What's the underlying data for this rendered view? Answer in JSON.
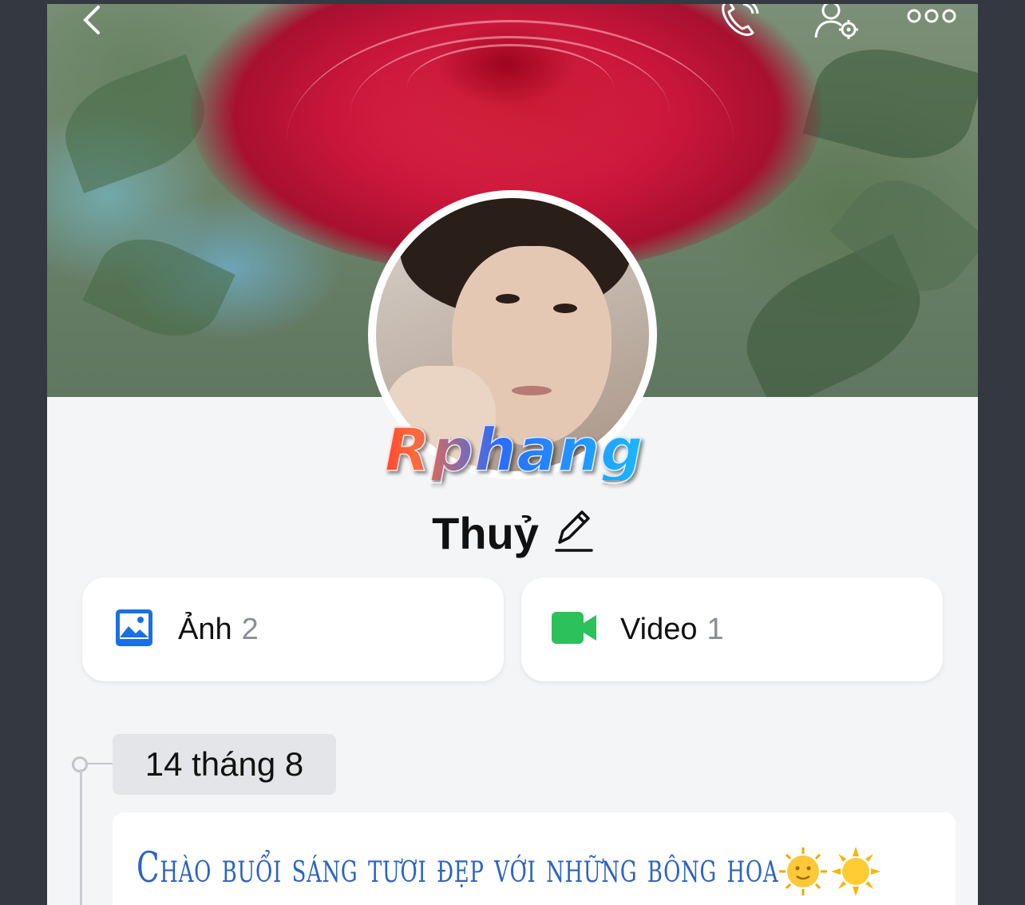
{
  "profile": {
    "name": "Thuỷ",
    "watermark": "Rphang"
  },
  "media": {
    "photos": {
      "label": "Ảnh",
      "count": "2",
      "icon": "photo-icon"
    },
    "videos": {
      "label": "Video",
      "count": "1",
      "icon": "video-camera-icon"
    }
  },
  "timeline": {
    "date": "14 tháng 8",
    "post_text": "Chào buổi sáng tươi đẹp với những bông hoa",
    "emojis": [
      "sun-with-face-icon",
      "sun-icon"
    ]
  },
  "top_bar": {
    "icons": [
      "back-icon",
      "phone-call-icon",
      "user-settings-icon",
      "more-options-icon"
    ]
  },
  "colors": {
    "accent_blue": "#1a6fe6",
    "video_green": "#2cc15a",
    "post_text_blue": "#2b64c4"
  }
}
